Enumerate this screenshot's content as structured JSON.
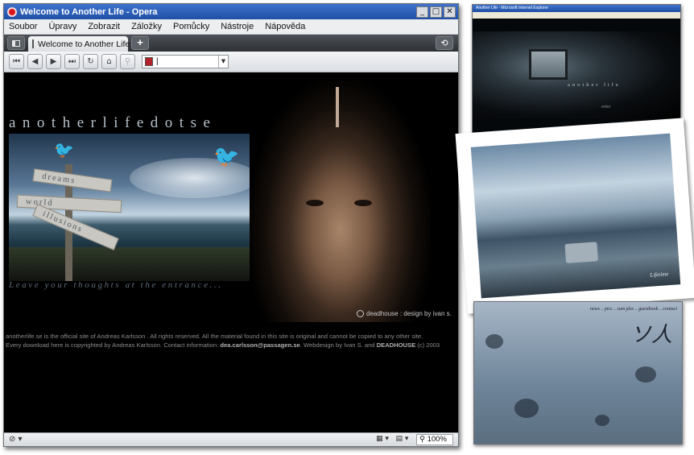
{
  "window": {
    "title": "Welcome to Another Life - Opera",
    "controls": [
      "_",
      "□",
      "✕"
    ]
  },
  "menu": [
    "Soubor",
    "Úpravy",
    "Zobrazit",
    "Záložky",
    "Pomůcky",
    "Nástroje",
    "Nápověda"
  ],
  "tab": {
    "label": "Welcome to Another Life",
    "close": "✕"
  },
  "address": {
    "value": "|"
  },
  "site": {
    "title": "anotherlifedotse",
    "signs": [
      "dreams",
      "world",
      "illusions"
    ],
    "tagline": "Leave your thoughts at the entrance...",
    "credit": "deadhouse : design by ivan s.",
    "footer_line1": "anotherlife.se is the official site of Andreas Karlsson . All rights reserved. All the material found in this site is original and cannot be copied to any other site.",
    "footer_line2_a": "Every download here is copyrighted by Andreas Karlsson. Contact information: ",
    "footer_email": "dea.carlsson@passagen.se",
    "footer_line2_b": ". Webdesign by Ivan S. and ",
    "footer_deadhouse": "DEADHOUSE",
    "footer_year": " (c) 2003"
  },
  "status": {
    "zoom": "100%"
  },
  "thumbs": {
    "first_title": "Another Life - Microsoft Internet Explorer",
    "first_caption": "another life",
    "first_enter": "enter",
    "photo_signature": "Lifetime",
    "third_nav": "news .. pics .. sum plzs .. guestbook .. contact"
  }
}
